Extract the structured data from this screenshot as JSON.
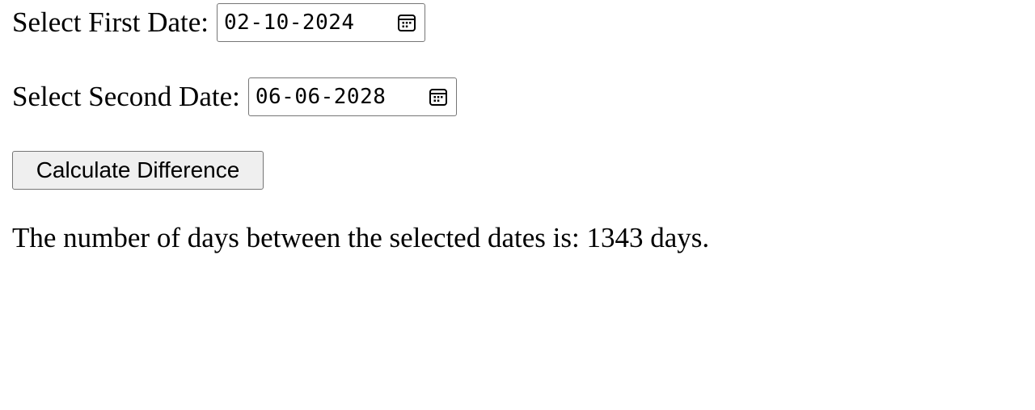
{
  "form": {
    "first_date": {
      "label": "Select First Date:",
      "value": "02-10-2024",
      "icon": "calendar-icon"
    },
    "second_date": {
      "label": "Select Second Date:",
      "value": "06-06-2028",
      "icon": "calendar-icon"
    },
    "calculate_button_label": "Calculate Difference"
  },
  "result": {
    "text": "The number of days between the selected dates is: 1343 days."
  }
}
